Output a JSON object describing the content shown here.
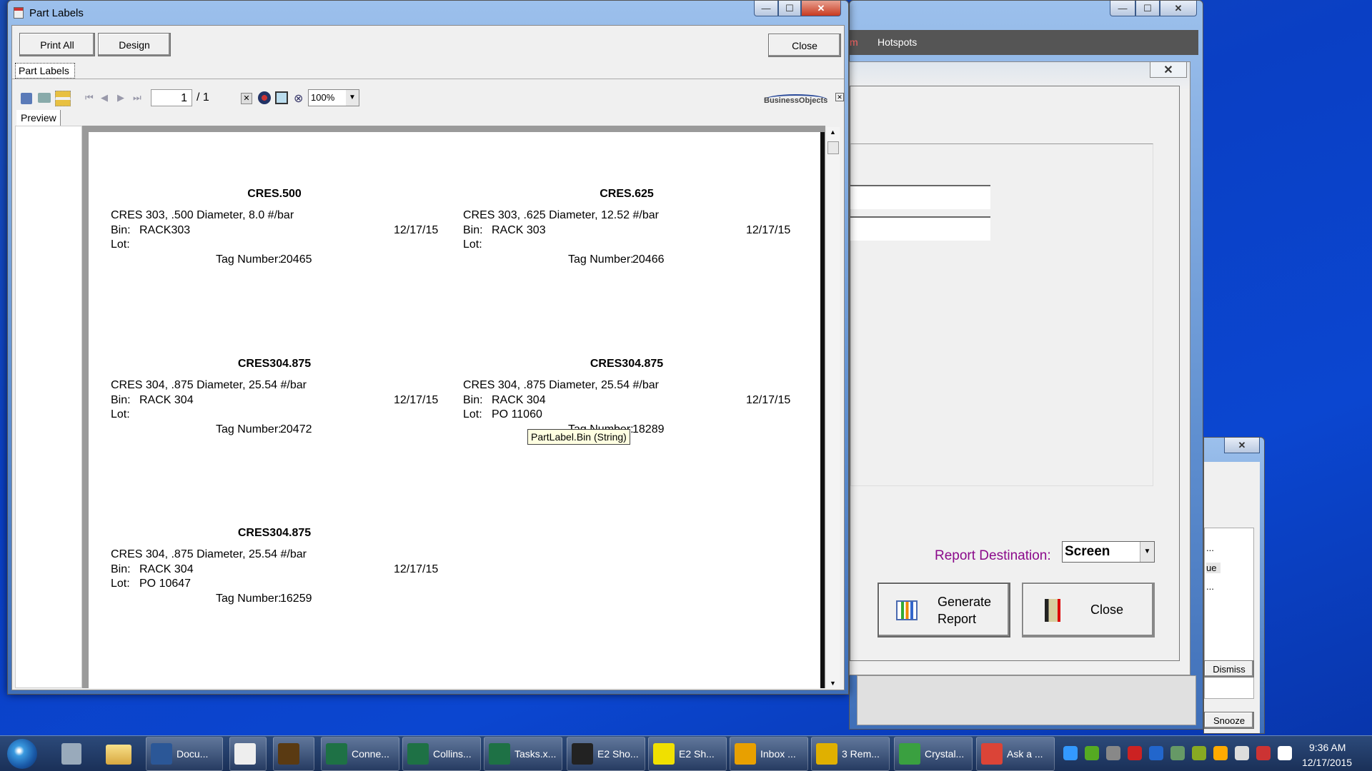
{
  "part_labels_window": {
    "title": "Part Labels",
    "buttons": {
      "print_all": "Print All",
      "design": "Design",
      "close": "Close"
    },
    "tab": "Part Labels",
    "viewer": {
      "page_current": "1",
      "page_total": "/ 1",
      "zoom": "100%",
      "logo": "BusinessObjects",
      "preview_tab": "Preview",
      "labels": [
        {
          "part": "CRES.500",
          "desc": "CRES 303, .500 Diameter, 8.0 #/bar",
          "bin_label": "Bin:",
          "bin": "RACK303",
          "date": "12/17/15",
          "lot_label": "Lot:",
          "lot": "",
          "tag_label": "Tag Number:",
          "tag": "20465"
        },
        {
          "part": "CRES.625",
          "desc": "CRES 303, .625 Diameter, 12.52 #/bar",
          "bin_label": "Bin:",
          "bin": "RACK 303",
          "date": "12/17/15",
          "lot_label": "Lot:",
          "lot": "",
          "tag_label": "Tag Number:",
          "tag": "20466"
        },
        {
          "part": "CRES304.875",
          "desc": "CRES 304, .875 Diameter, 25.54 #/bar",
          "bin_label": "Bin:",
          "bin": "RACK 304",
          "date": "12/17/15",
          "lot_label": "Lot:",
          "lot": "",
          "tag_label": "Tag Number:",
          "tag": "20472"
        },
        {
          "part": "CRES304.875",
          "desc": "CRES 304, .875 Diameter, 25.54 #/bar",
          "bin_label": "Bin:",
          "bin": "RACK 304",
          "date": "12/17/15",
          "lot_label": "Lot:",
          "lot": "PO 11060",
          "tag_label": "Tag Number:",
          "tag": "18289"
        },
        {
          "part": "CRES304.875",
          "desc": "CRES 304, .875 Diameter, 25.54 #/bar",
          "bin_label": "Bin:",
          "bin": "RACK 304",
          "date": "12/17/15",
          "lot_label": "Lot:",
          "lot": "PO 10647",
          "tag_label": "Tag Number:",
          "tag": "16259"
        }
      ],
      "tooltip": "PartLabel.Bin (String)"
    }
  },
  "main_window": {
    "menu_fragment": "m",
    "menu_hotspots": "Hotspots",
    "report_destination_label": "Report Destination:",
    "report_destination_value": "Screen",
    "generate_report": "Generate Report",
    "close": "Close",
    "label_color": "#8b0a8b"
  },
  "reminder_window": {
    "fragments": [
      "...",
      "ue",
      "..."
    ],
    "dismiss": "Dismiss",
    "snooze": "Snooze"
  },
  "taskbar": {
    "items": [
      {
        "label": "Docu...",
        "icon": "word-icon",
        "color": "#2b5797"
      },
      {
        "label": "",
        "icon": "calculator-icon",
        "color": "#eeeeee"
      },
      {
        "label": "",
        "icon": "ups-icon",
        "color": "#5a3a12"
      },
      {
        "label": "Conne...",
        "icon": "excel-icon",
        "color": "#1e7145"
      },
      {
        "label": "Collins...",
        "icon": "excel-icon",
        "color": "#1e7145"
      },
      {
        "label": "Tasks.x...",
        "icon": "excel-icon",
        "color": "#1e7145"
      },
      {
        "label": "E2 Sho...",
        "icon": "e2-shop-icon",
        "color": "#222222"
      },
      {
        "label": "E2 Sh...",
        "icon": "lightning-icon",
        "color": "#f0e000"
      },
      {
        "label": "Inbox ...",
        "icon": "outlook-icon",
        "color": "#e8a000"
      },
      {
        "label": "3 Rem...",
        "icon": "reminder-bell-icon",
        "color": "#e0b000"
      },
      {
        "label": "Crystal...",
        "icon": "crystal-reports-icon",
        "color": "#3aa040"
      },
      {
        "label": "Ask a ...",
        "icon": "chrome-icon",
        "color": "#db4437"
      }
    ],
    "tray_colors": [
      "#3399ff",
      "#55aa22",
      "#888888",
      "#cc2222",
      "#2266cc",
      "#669966",
      "#88aa22",
      "#ffaa00",
      "#dddddd",
      "#cc3333",
      "#ffffff"
    ],
    "time": "9:36 AM",
    "date": "12/17/2015"
  }
}
